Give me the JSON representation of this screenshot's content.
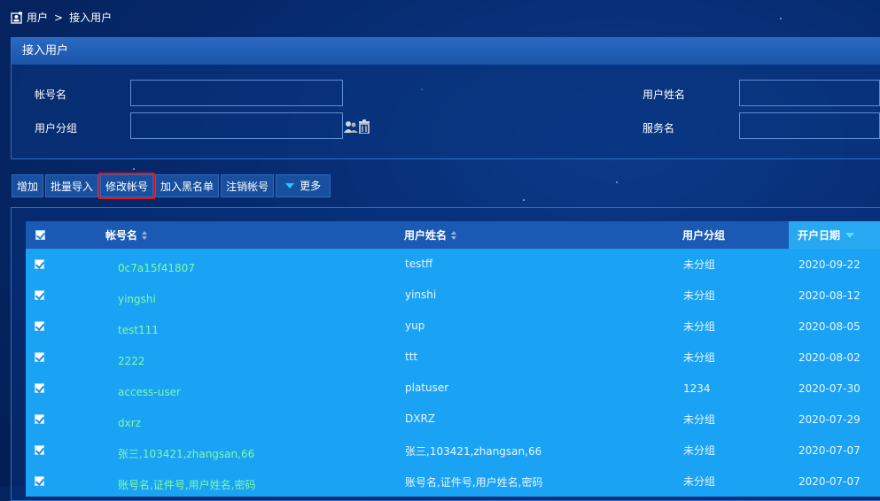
{
  "colors": {
    "accent": "#1aa3f4",
    "header": "#1a5ab5",
    "link": "#7dfca6",
    "highlight": "#e0131a"
  },
  "breadcrumb": {
    "items": [
      "用户",
      "接入用户"
    ],
    "separator": ">"
  },
  "panel": {
    "title": "接入用户"
  },
  "form": {
    "account_label": "帐号名",
    "user_name_label": "用户姓名",
    "user_group_label": "用户分组",
    "service_label": "服务名",
    "account_value": "",
    "user_name_value": "",
    "user_group_value": "",
    "service_value": "",
    "group_icons": [
      "users-icon",
      "trash-icon"
    ]
  },
  "toolbar": {
    "add": "增加",
    "import": "批量导入",
    "modify": "修改帐号",
    "blacklist": "加入黑名单",
    "cancel": "注销帐号",
    "more": "更多"
  },
  "table": {
    "headers": {
      "account": "帐号名",
      "user_name": "用户姓名",
      "group": "用户分组",
      "open_date": "开户日期"
    },
    "rows": [
      {
        "account": "0c7a15f41807",
        "user_name": "testff",
        "group": "未分组",
        "date": "2020-09-22"
      },
      {
        "account": "yingshi",
        "user_name": "yinshi",
        "group": "未分组",
        "date": "2020-08-12"
      },
      {
        "account": "test111",
        "user_name": "yup",
        "group": "未分组",
        "date": "2020-08-05"
      },
      {
        "account": "2222",
        "user_name": "ttt",
        "group": "未分组",
        "date": "2020-08-02"
      },
      {
        "account": "access-user",
        "user_name": "platuser",
        "group": "1234",
        "date": "2020-07-30"
      },
      {
        "account": "dxrz",
        "user_name": "DXRZ",
        "group": "未分组",
        "date": "2020-07-29"
      },
      {
        "account": "张三,103421,zhangsan,66",
        "user_name": "张三,103421,zhangsan,66",
        "group": "未分组",
        "date": "2020-07-07"
      },
      {
        "account": "账号名,证件号,用户姓名,密码",
        "user_name": "账号名,证件号,用户姓名,密码",
        "group": "未分组",
        "date": "2020-07-07"
      }
    ]
  }
}
